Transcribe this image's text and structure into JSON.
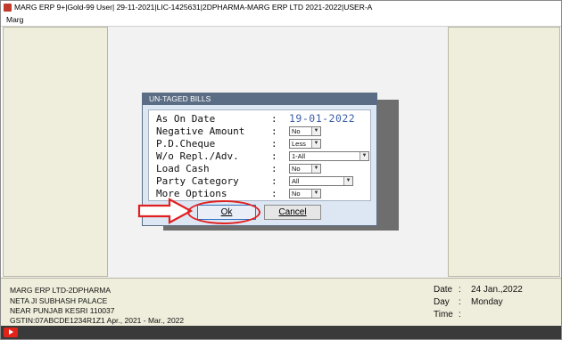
{
  "window": {
    "title": "MARG ERP 9+|Gold-99 User| 29-11-2021|LIC-1425631|2DPHARMA-MARG ERP LTD 2021-2022|USER-A"
  },
  "menu": {
    "item": "Marg"
  },
  "dialog": {
    "title": "UN-TAGED BILLS",
    "fields": {
      "as_on_date": {
        "label": "As On Date",
        "value": "19-01-2022"
      },
      "negative_amount": {
        "label": "Negative Amount",
        "value": "No"
      },
      "pd_cheque": {
        "label": "P.D.Cheque",
        "value": "Less"
      },
      "wo_repl_adv": {
        "label": "W/o Repl./Adv.",
        "value": "1-All"
      },
      "load_cash": {
        "label": "Load Cash",
        "value": "No"
      },
      "party_category": {
        "label": "Party Category",
        "value": "All"
      },
      "more_options": {
        "label": "More Options",
        "value": "No"
      }
    },
    "colon": ":",
    "ok_label": "Ok",
    "cancel_label": "Cancel"
  },
  "status": {
    "company": "MARG ERP LTD-2DPHARMA",
    "address1": "NETA JI SUBHASH PALACE",
    "address2": "NEAR PUNJAB KESRI 110037",
    "gstin_line": "GSTIN:07ABCDE1234R1Z1  Apr., 2021 - Mar., 2022",
    "date_label": "Date",
    "date_value": "24 Jan.,2022",
    "day_label": "Day",
    "day_value": "Monday",
    "time_label": "Time",
    "time_value": "",
    "colon": ":"
  },
  "colors": {
    "dialog_title_bg": "#5b6d84",
    "dialog_bg": "#dde6f3",
    "date_value": "#3c5ea8",
    "annotation_red": "#e02020",
    "side_panel": "#efeedc"
  },
  "icons": {
    "app": "marg-app-icon",
    "dropdown": "chevron-down-icon",
    "annotation": "red-arrow-icon",
    "taskbar": "play-icon"
  }
}
